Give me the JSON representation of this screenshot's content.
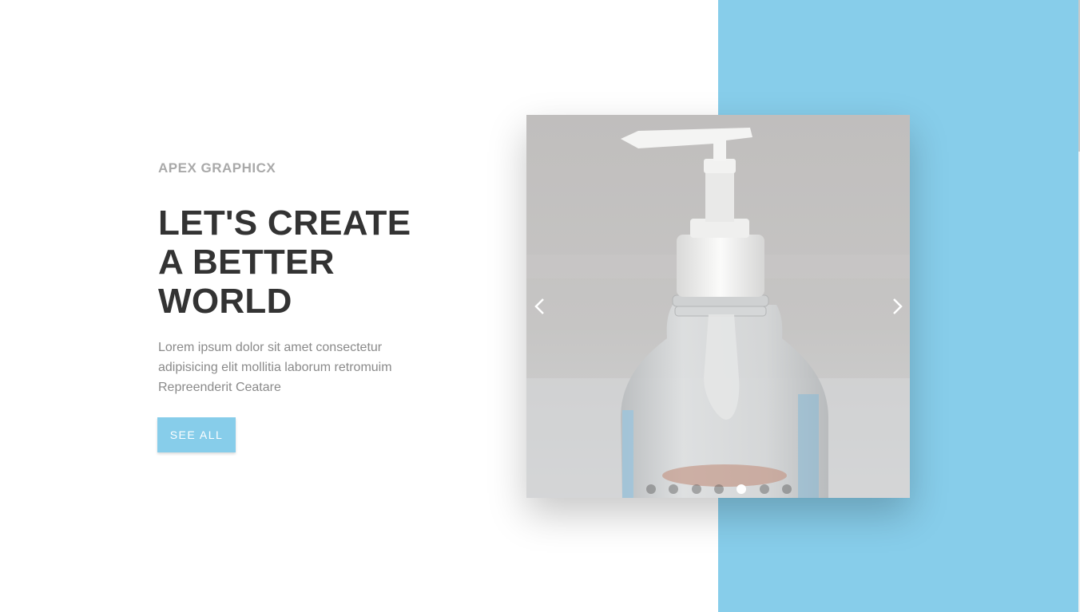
{
  "brand": "APEX GRAPHICX",
  "headline": {
    "line1": "LET'S CREATE",
    "line2": "A BETTER",
    "line3": "WORLD"
  },
  "description": {
    "line1": "Lorem ipsum dolor sit amet consectetur",
    "line2": "adipisicing elit mollitia laborum retromuim",
    "line3": "Repreenderit Ceatare"
  },
  "cta": {
    "label": "SEE ALL"
  },
  "carousel": {
    "image": "hand-sanitizer-pump-bottle",
    "prev_icon": "chevron-left-icon",
    "next_icon": "chevron-right-icon",
    "slide_count": 7,
    "active_slide": 5
  },
  "colors": {
    "accent": "#87cdea",
    "heading": "#333333",
    "brand_text": "#a9a9a9",
    "body_text": "#8a8a8a"
  }
}
